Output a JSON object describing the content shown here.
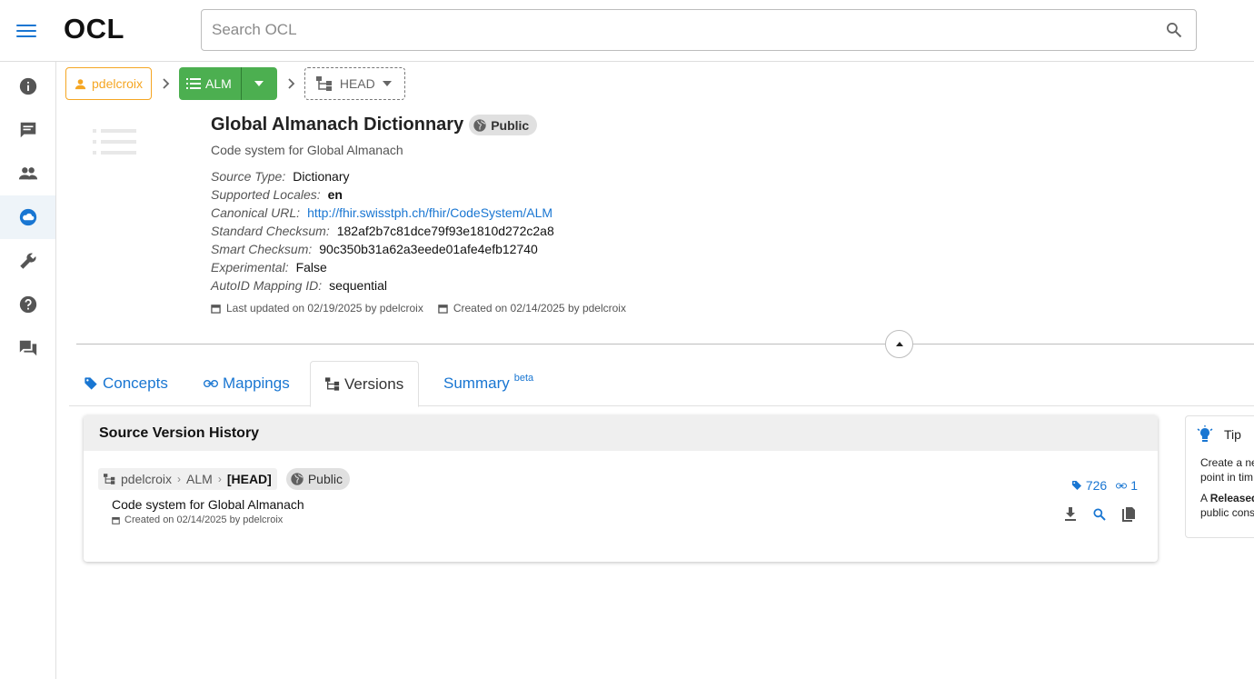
{
  "app": {
    "logo": "OCL"
  },
  "search": {
    "placeholder": "Search OCL"
  },
  "sidebar": {
    "items": [
      "info-icon",
      "chat-icon",
      "people-icon",
      "cloud-icon",
      "wrench-icon",
      "help-icon",
      "forum-icon"
    ],
    "active_index": 3
  },
  "breadcrumb": {
    "owner": "pdelcroix",
    "repo": "ALM",
    "version": "HEAD"
  },
  "source": {
    "title": "Global Almanach Dictionnary",
    "visibility": "Public",
    "description": "Code system for Global Almanach",
    "properties": [
      {
        "key": "Source Type:",
        "value": "Dictionary"
      },
      {
        "key": "Supported Locales:",
        "value": "en"
      },
      {
        "key": "Canonical URL:",
        "value": "http://fhir.swisstph.ch/fhir/CodeSystem/ALM"
      },
      {
        "key": "Standard Checksum:",
        "value": "182af2b7c81dce79f93e1810d272c2a8"
      },
      {
        "key": "Smart Checksum:",
        "value": "90c350b31a62a3eede01afe4efb12740"
      },
      {
        "key": "Experimental:",
        "value": "False"
      },
      {
        "key": "AutoID Mapping ID:",
        "value": "sequential"
      }
    ],
    "last_updated": "Last updated on 02/19/2025 by pdelcroix",
    "created": "Created on 02/14/2025 by pdelcroix"
  },
  "tabs": [
    {
      "label": "Concepts"
    },
    {
      "label": "Mappings"
    },
    {
      "label": "Versions"
    },
    {
      "label": "Summary",
      "sup": "beta"
    }
  ],
  "versions_panel": {
    "title": "Source Version History",
    "rows": [
      {
        "owner": "pdelcroix",
        "repo": "ALM",
        "version": "[HEAD]",
        "visibility": "Public",
        "description": "Code system for Global Almanach",
        "created": "Created on 02/14/2025 by pdelcroix",
        "concepts_count": "726",
        "mappings_count": "1"
      }
    ]
  },
  "tip": {
    "title": "Tip",
    "line1": "Create a ne",
    "line2": "point in tim",
    "line3_bold": "Released",
    "line3_prefix": "A ",
    "line4": "public cons"
  },
  "colors": {
    "primary": "#1976d2",
    "owner": "#f5a623",
    "repo": "#4caf50"
  }
}
